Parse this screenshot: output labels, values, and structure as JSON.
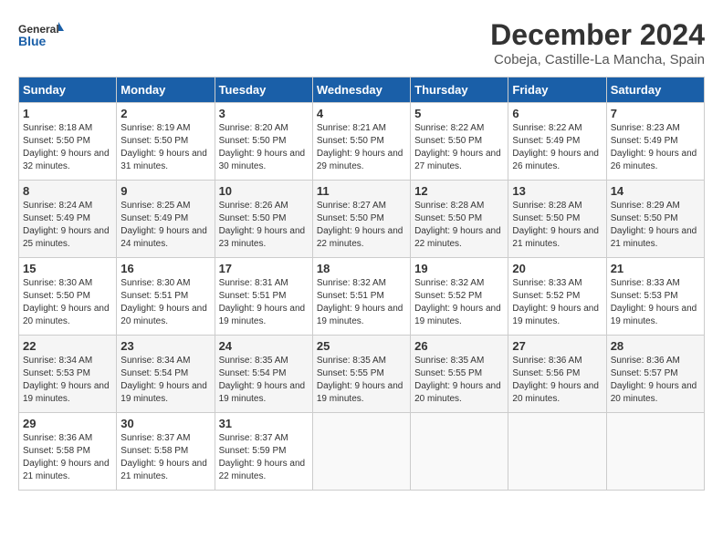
{
  "logo": {
    "general": "General",
    "blue": "Blue"
  },
  "title": "December 2024",
  "location": "Cobeja, Castille-La Mancha, Spain",
  "days_of_week": [
    "Sunday",
    "Monday",
    "Tuesday",
    "Wednesday",
    "Thursday",
    "Friday",
    "Saturday"
  ],
  "weeks": [
    [
      {
        "day": "1",
        "sunrise": "8:18 AM",
        "sunset": "5:50 PM",
        "daylight": "9 hours and 32 minutes."
      },
      {
        "day": "2",
        "sunrise": "8:19 AM",
        "sunset": "5:50 PM",
        "daylight": "9 hours and 31 minutes."
      },
      {
        "day": "3",
        "sunrise": "8:20 AM",
        "sunset": "5:50 PM",
        "daylight": "9 hours and 30 minutes."
      },
      {
        "day": "4",
        "sunrise": "8:21 AM",
        "sunset": "5:50 PM",
        "daylight": "9 hours and 29 minutes."
      },
      {
        "day": "5",
        "sunrise": "8:22 AM",
        "sunset": "5:50 PM",
        "daylight": "9 hours and 27 minutes."
      },
      {
        "day": "6",
        "sunrise": "8:22 AM",
        "sunset": "5:49 PM",
        "daylight": "9 hours and 26 minutes."
      },
      {
        "day": "7",
        "sunrise": "8:23 AM",
        "sunset": "5:49 PM",
        "daylight": "9 hours and 26 minutes."
      }
    ],
    [
      {
        "day": "8",
        "sunrise": "8:24 AM",
        "sunset": "5:49 PM",
        "daylight": "9 hours and 25 minutes."
      },
      {
        "day": "9",
        "sunrise": "8:25 AM",
        "sunset": "5:49 PM",
        "daylight": "9 hours and 24 minutes."
      },
      {
        "day": "10",
        "sunrise": "8:26 AM",
        "sunset": "5:50 PM",
        "daylight": "9 hours and 23 minutes."
      },
      {
        "day": "11",
        "sunrise": "8:27 AM",
        "sunset": "5:50 PM",
        "daylight": "9 hours and 22 minutes."
      },
      {
        "day": "12",
        "sunrise": "8:28 AM",
        "sunset": "5:50 PM",
        "daylight": "9 hours and 22 minutes."
      },
      {
        "day": "13",
        "sunrise": "8:28 AM",
        "sunset": "5:50 PM",
        "daylight": "9 hours and 21 minutes."
      },
      {
        "day": "14",
        "sunrise": "8:29 AM",
        "sunset": "5:50 PM",
        "daylight": "9 hours and 21 minutes."
      }
    ],
    [
      {
        "day": "15",
        "sunrise": "8:30 AM",
        "sunset": "5:50 PM",
        "daylight": "9 hours and 20 minutes."
      },
      {
        "day": "16",
        "sunrise": "8:30 AM",
        "sunset": "5:51 PM",
        "daylight": "9 hours and 20 minutes."
      },
      {
        "day": "17",
        "sunrise": "8:31 AM",
        "sunset": "5:51 PM",
        "daylight": "9 hours and 19 minutes."
      },
      {
        "day": "18",
        "sunrise": "8:32 AM",
        "sunset": "5:51 PM",
        "daylight": "9 hours and 19 minutes."
      },
      {
        "day": "19",
        "sunrise": "8:32 AM",
        "sunset": "5:52 PM",
        "daylight": "9 hours and 19 minutes."
      },
      {
        "day": "20",
        "sunrise": "8:33 AM",
        "sunset": "5:52 PM",
        "daylight": "9 hours and 19 minutes."
      },
      {
        "day": "21",
        "sunrise": "8:33 AM",
        "sunset": "5:53 PM",
        "daylight": "9 hours and 19 minutes."
      }
    ],
    [
      {
        "day": "22",
        "sunrise": "8:34 AM",
        "sunset": "5:53 PM",
        "daylight": "9 hours and 19 minutes."
      },
      {
        "day": "23",
        "sunrise": "8:34 AM",
        "sunset": "5:54 PM",
        "daylight": "9 hours and 19 minutes."
      },
      {
        "day": "24",
        "sunrise": "8:35 AM",
        "sunset": "5:54 PM",
        "daylight": "9 hours and 19 minutes."
      },
      {
        "day": "25",
        "sunrise": "8:35 AM",
        "sunset": "5:55 PM",
        "daylight": "9 hours and 19 minutes."
      },
      {
        "day": "26",
        "sunrise": "8:35 AM",
        "sunset": "5:55 PM",
        "daylight": "9 hours and 20 minutes."
      },
      {
        "day": "27",
        "sunrise": "8:36 AM",
        "sunset": "5:56 PM",
        "daylight": "9 hours and 20 minutes."
      },
      {
        "day": "28",
        "sunrise": "8:36 AM",
        "sunset": "5:57 PM",
        "daylight": "9 hours and 20 minutes."
      }
    ],
    [
      {
        "day": "29",
        "sunrise": "8:36 AM",
        "sunset": "5:58 PM",
        "daylight": "9 hours and 21 minutes."
      },
      {
        "day": "30",
        "sunrise": "8:37 AM",
        "sunset": "5:58 PM",
        "daylight": "9 hours and 21 minutes."
      },
      {
        "day": "31",
        "sunrise": "8:37 AM",
        "sunset": "5:59 PM",
        "daylight": "9 hours and 22 minutes."
      },
      null,
      null,
      null,
      null
    ]
  ],
  "labels": {
    "sunrise": "Sunrise: ",
    "sunset": "Sunset: ",
    "daylight": "Daylight: "
  }
}
